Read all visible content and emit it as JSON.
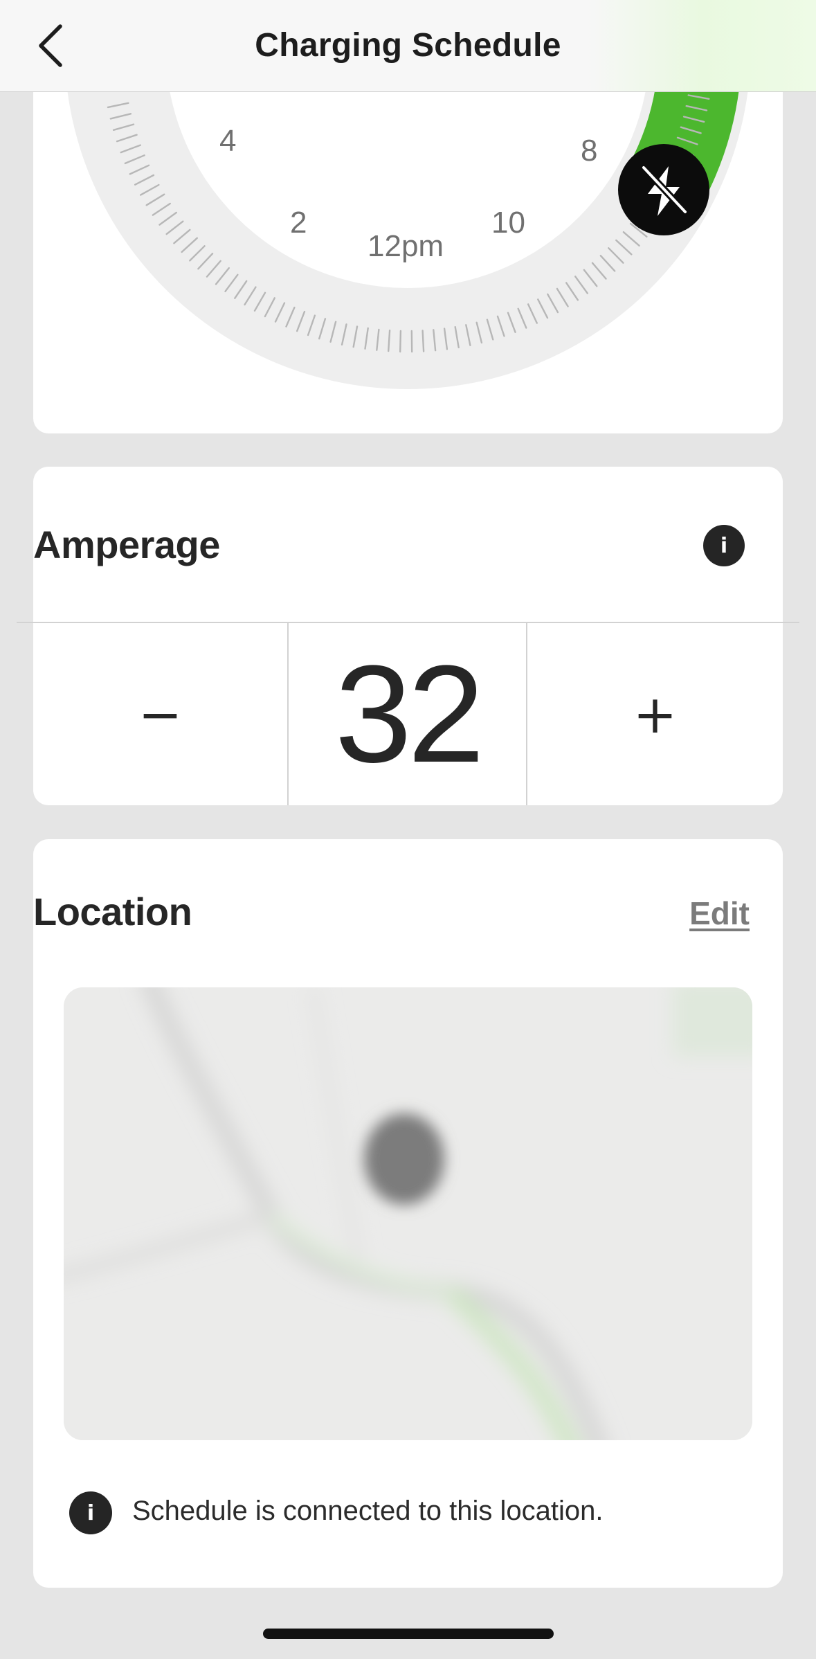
{
  "header": {
    "title": "Charging Schedule",
    "back_icon": "chevron-left-icon"
  },
  "schedule_dial": {
    "hour_labels": [
      "4",
      "8",
      "2",
      "10",
      "12pm"
    ],
    "charging_arc_color": "#4cb72e",
    "handle_icon": "no-charging-bolt-icon"
  },
  "amperage": {
    "title": "Amperage",
    "info_icon": "i",
    "decrement_label": "−",
    "value": "32",
    "increment_label": "+"
  },
  "location": {
    "title": "Location",
    "edit_label": "Edit",
    "info_icon": "i",
    "note": "Schedule is connected to this location."
  },
  "colors": {
    "background": "#e5e5e5",
    "card": "#ffffff",
    "accent_green": "#4cb72e",
    "text": "#262626"
  }
}
